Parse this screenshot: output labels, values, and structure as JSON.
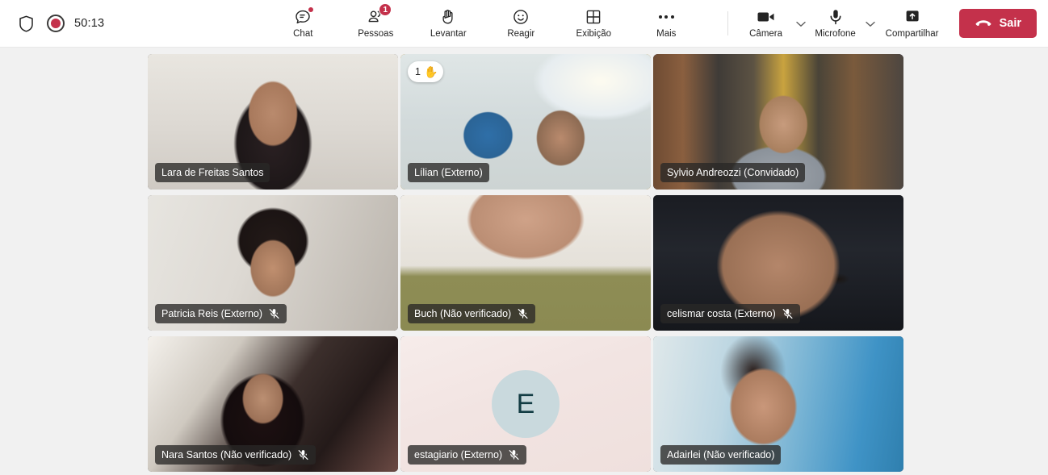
{
  "toolbar": {
    "shield_icon": "shield-icon",
    "recording": {
      "icon": "record-dot-icon",
      "timer": "50:13"
    },
    "center_items": [
      {
        "icon": "chat-bubble-icon",
        "label": "Chat",
        "badge_dot": true
      },
      {
        "icon": "people-icon",
        "label": "Pessoas",
        "badge_count": "1"
      },
      {
        "icon": "raise-hand-icon",
        "label": "Levantar"
      },
      {
        "icon": "smiley-react-icon",
        "label": "Reagir"
      },
      {
        "icon": "grid-view-icon",
        "label": "Exibição"
      },
      {
        "icon": "more-ellipsis-icon",
        "label": "Mais"
      }
    ],
    "right_items": [
      {
        "icon": "camera-icon",
        "label": "Câmera",
        "has_chevron": true
      },
      {
        "icon": "microphone-icon",
        "label": "Microfone",
        "has_chevron": true
      },
      {
        "icon": "share-screen-icon",
        "label": "Compartilhar",
        "has_chevron": false
      }
    ],
    "leave": {
      "label": "Sair",
      "icon": "hangup-phone-icon",
      "color": "#c4314b"
    }
  },
  "colors": {
    "accent_red": "#c4314b",
    "hand_border": "#eaa300",
    "speaking_border": "#5b5fc7",
    "stage_bg": "#f1f1f1",
    "avatar_bg": "#c9d9dd",
    "avatar_fg": "#123c43"
  },
  "grid": {
    "columns": 3,
    "rows": 3,
    "participants": [
      {
        "name": "Lara de Freitas Santos",
        "video_class": "v-lara",
        "muted": false,
        "hand_raised": false,
        "speaking": false,
        "video_on": true,
        "avatar_initial": ""
      },
      {
        "name": "Lílian (Externo)",
        "video_class": "v-lilian",
        "muted": false,
        "hand_raised": true,
        "hand_count": "1",
        "hand_glyph": "✋",
        "speaking": false,
        "video_on": true,
        "avatar_initial": ""
      },
      {
        "name": "Sylvio Andreozzi (Convidado)",
        "video_class": "v-sylvio",
        "muted": false,
        "hand_raised": false,
        "speaking": true,
        "video_on": true,
        "avatar_initial": ""
      },
      {
        "name": "Patricia Reis (Externo)",
        "video_class": "v-patricia",
        "muted": true,
        "hand_raised": false,
        "speaking": false,
        "video_on": true,
        "avatar_initial": ""
      },
      {
        "name": "Buch (Não verificado)",
        "video_class": "v-buch",
        "muted": true,
        "hand_raised": false,
        "speaking": false,
        "video_on": true,
        "avatar_initial": ""
      },
      {
        "name": "celismar costa (Externo)",
        "video_class": "v-celismar",
        "muted": true,
        "hand_raised": false,
        "speaking": false,
        "video_on": true,
        "avatar_initial": ""
      },
      {
        "name": "Nara Santos (Não verificado)",
        "video_class": "v-nara",
        "muted": true,
        "hand_raised": false,
        "speaking": false,
        "video_on": true,
        "avatar_initial": ""
      },
      {
        "name": "estagiario (Externo)",
        "video_class": "v-estagiario",
        "muted": true,
        "hand_raised": false,
        "speaking": false,
        "video_on": false,
        "avatar_initial": "E"
      },
      {
        "name": "Adairlei (Não verificado)",
        "video_class": "v-adairlei",
        "muted": false,
        "hand_raised": false,
        "speaking": false,
        "video_on": true,
        "avatar_initial": ""
      }
    ]
  }
}
